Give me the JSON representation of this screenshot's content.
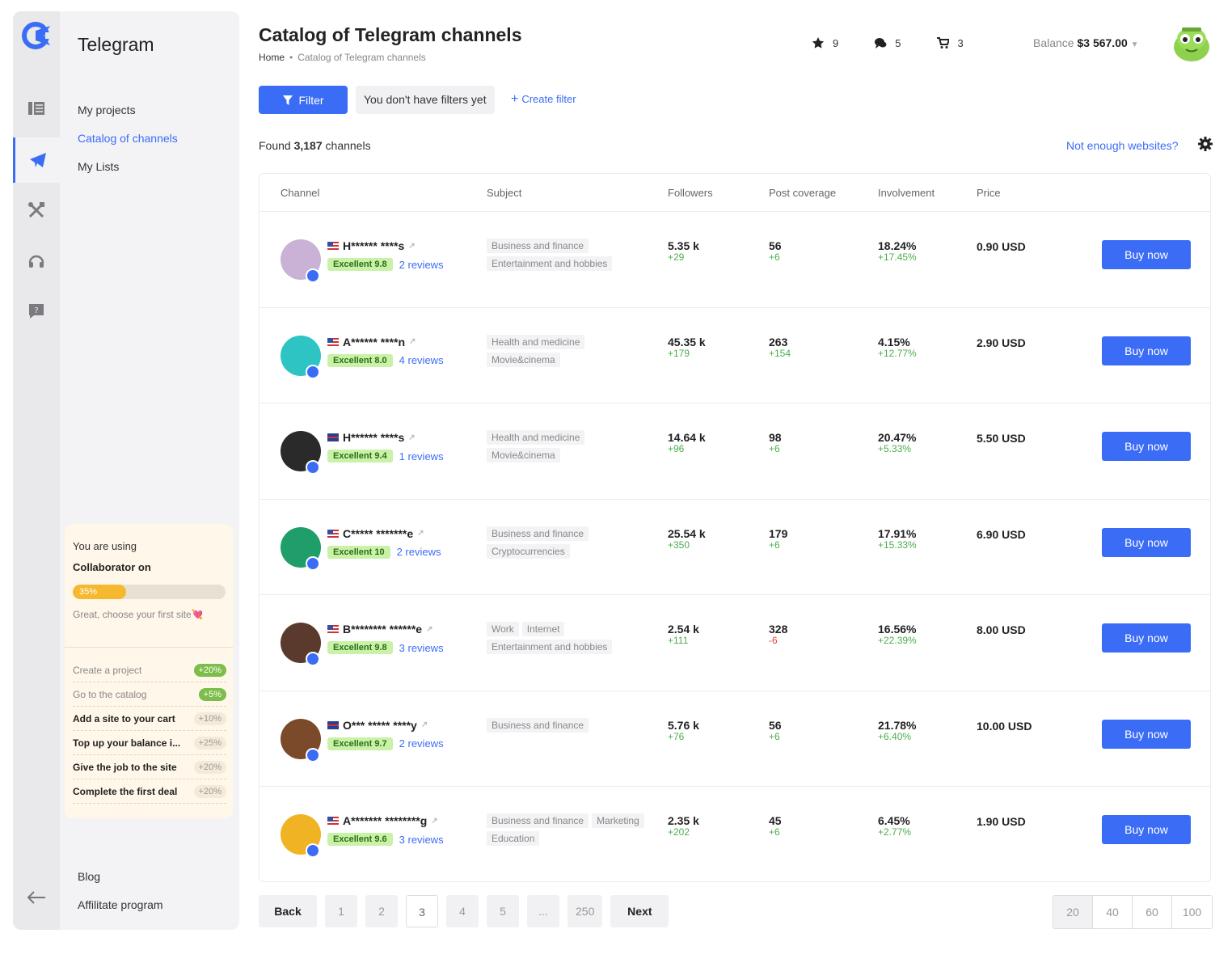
{
  "sidebar": {
    "title": "Telegram",
    "nav": [
      "My projects",
      "Catalog of channels",
      "My Lists"
    ],
    "progress": {
      "using": "You are using",
      "plan": "Collaborator on",
      "percent_label": "35%",
      "percent": 35,
      "hint": "Great, choose your first site💘",
      "tasks": [
        {
          "label": "Create a project",
          "bonus": "+20%",
          "done": true
        },
        {
          "label": "Go to the catalog",
          "bonus": "+5%",
          "done": true
        },
        {
          "label": "Add a site to your cart",
          "bonus": "+10%",
          "done": false
        },
        {
          "label": "Top up your balance i...",
          "bonus": "+25%",
          "done": false
        },
        {
          "label": "Give the job to the site",
          "bonus": "+20%",
          "done": false
        },
        {
          "label": "Complete the first deal",
          "bonus": "+20%",
          "done": false
        }
      ]
    },
    "bottom": [
      "Blog",
      "Affilitate program"
    ]
  },
  "header": {
    "title": "Catalog of Telegram channels",
    "breadcrumb_home": "Home",
    "breadcrumb_current": "Catalog of Telegram channels",
    "favorites": "9",
    "messages": "5",
    "cart": "3",
    "balance_label": "Balance",
    "balance_value": "$3 567.00"
  },
  "filters": {
    "filter_label": "Filter",
    "no_filters": "You don't have filters yet",
    "create_filter": "Create filter"
  },
  "summary": {
    "found_prefix": "Found",
    "count": "3,187",
    "found_suffix": "channels",
    "not_enough": "Not enough websites?"
  },
  "table": {
    "headers": [
      "Channel",
      "Subject",
      "Followers",
      "Post coverage",
      "Involvement",
      "Price"
    ],
    "buy_label": "Buy now",
    "rows": [
      {
        "name": "H****** ****s",
        "flag": "us",
        "rating": "Excellent 9.8",
        "reviews": "2 reviews",
        "subjects": [
          "Business and finance",
          "Entertainment and hobbies"
        ],
        "followers": "5.35 k",
        "followers_delta": "+29",
        "coverage": "56",
        "coverage_delta": "+6",
        "involvement": "18.24%",
        "involvement_delta": "+17.45%",
        "price": "0.90 USD",
        "avatar_color": "#c9b2d6"
      },
      {
        "name": "A****** ****n",
        "flag": "us",
        "rating": "Excellent 8.0",
        "reviews": "4 reviews",
        "subjects": [
          "Health and medicine",
          "Movie&cinema"
        ],
        "followers": "45.35 k",
        "followers_delta": "+179",
        "coverage": "263",
        "coverage_delta": "+154",
        "involvement": "4.15%",
        "involvement_delta": "+12.77%",
        "price": "2.90 USD",
        "avatar_color": "#2ec4c4"
      },
      {
        "name": "H****** ****s",
        "flag": "gb",
        "rating": "Excellent 9.4",
        "reviews": "1 reviews",
        "subjects": [
          "Health and medicine",
          "Movie&cinema"
        ],
        "followers": "14.64 k",
        "followers_delta": "+96",
        "coverage": "98",
        "coverage_delta": "+6",
        "involvement": "20.47%",
        "involvement_delta": "+5.33%",
        "price": "5.50 USD",
        "avatar_color": "#2a2a2a"
      },
      {
        "name": "C***** *******e",
        "flag": "us",
        "rating": "Excellent 10",
        "reviews": "2 reviews",
        "subjects": [
          "Business and finance",
          "Cryptocurrencies"
        ],
        "followers": "25.54 k",
        "followers_delta": "+350",
        "coverage": "179",
        "coverage_delta": "+6",
        "involvement": "17.91%",
        "involvement_delta": "+15.33%",
        "price": "6.90 USD",
        "avatar_color": "#1f9e6a"
      },
      {
        "name": "B******** ******e",
        "flag": "us",
        "rating": "Excellent 9.8",
        "reviews": "3 reviews",
        "subjects": [
          "Work",
          "Internet",
          "Entertainment and hobbies"
        ],
        "followers": "2.54 k",
        "followers_delta": "+111",
        "coverage": "328",
        "coverage_delta": "-6",
        "involvement": "16.56%",
        "involvement_delta": "+22.39%",
        "price": "8.00 USD",
        "avatar_color": "#5a3a2c"
      },
      {
        "name": "O*** ***** ****y",
        "flag": "gb",
        "rating": "Excellent 9.7",
        "reviews": "2 reviews",
        "subjects": [
          "Business and finance"
        ],
        "followers": "5.76 k",
        "followers_delta": "+76",
        "coverage": "56",
        "coverage_delta": "+6",
        "involvement": "21.78%",
        "involvement_delta": "+6.40%",
        "price": "10.00 USD",
        "avatar_color": "#7a4a2a"
      },
      {
        "name": "A******* ********g",
        "flag": "us",
        "rating": "Excellent 9.6",
        "reviews": "3 reviews",
        "subjects": [
          "Business and finance",
          "Marketing",
          "Education"
        ],
        "followers": "2.35 k",
        "followers_delta": "+202",
        "coverage": "45",
        "coverage_delta": "+6",
        "involvement": "6.45%",
        "involvement_delta": "+2.77%",
        "price": "1.90 USD",
        "avatar_color": "#f0b323"
      }
    ]
  },
  "pagination": {
    "back": "Back",
    "next": "Next",
    "pages": [
      "1",
      "2",
      "3",
      "4",
      "5",
      "...",
      "250"
    ],
    "current": "3",
    "per_page": [
      "20",
      "40",
      "60",
      "100"
    ],
    "per_page_active": "20"
  },
  "colors": {
    "accent": "#3b6cf6",
    "positive": "#4cae4c",
    "negative": "#e0433b"
  }
}
